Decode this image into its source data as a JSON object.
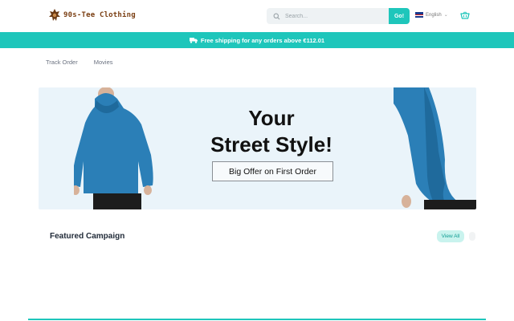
{
  "header": {
    "logo_text": "90s-Tee Clothing",
    "search_placeholder": "Search...",
    "go_label": "Go!",
    "language": "English",
    "icons": [
      "search-icon",
      "chevron-down-icon",
      "cart-icon",
      "flag-uk-icon",
      "logo-icon"
    ]
  },
  "shipping_bar": {
    "text": "Free shipping for any orders above  €112.01",
    "icon": "truck-icon"
  },
  "nav": {
    "items": [
      {
        "label": "Track Order"
      },
      {
        "label": "Movies"
      }
    ]
  },
  "banner": {
    "headline_line1": "Your",
    "headline_line2": "Street Style!",
    "offer_label": "Big Offer on First Order"
  },
  "featured": {
    "title": "Featured Campaign",
    "view_all_label": "View All"
  },
  "colors": {
    "accent": "#1ec6bb",
    "logo_text": "#7a3e12",
    "hoodie": "#2b7fb7"
  }
}
